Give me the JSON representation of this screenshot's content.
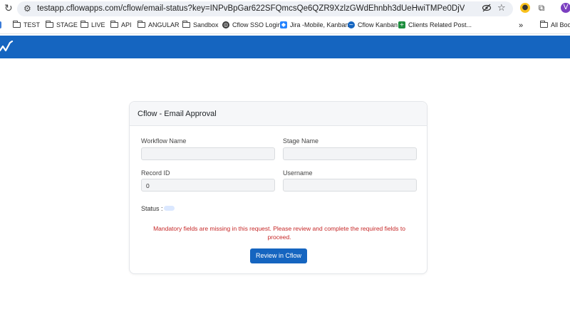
{
  "browser": {
    "url": "testapp.cflowapps.com/cflow/email-status?key=INPvBpGar622SFQmcsQe6QZR9XzlzGWdEhnbh3dUeHwiTMPe0DjV7DiliV9WpPuHm3WVFbOzB7jtUiyKJ2i...",
    "profile_initial": "V",
    "bookmarks": [
      "TEST",
      "STAGE",
      "LIVE",
      "API",
      "ANGULAR",
      "Sandbox",
      "Cflow SSO Login",
      "Jira -Mobile, Kanban",
      "Cflow Kanban",
      "Clients Related Post...",
      "All Book"
    ],
    "overflow": "»"
  },
  "colors": {
    "brand": "#1565c0",
    "error": "#c62828",
    "status_badge": "#dbe8ff"
  },
  "card": {
    "title": "Cflow - Email Approval",
    "fields": {
      "workflow_name": {
        "label": "Workflow Name",
        "value": ""
      },
      "stage_name": {
        "label": "Stage Name",
        "value": ""
      },
      "record_id": {
        "label": "Record ID",
        "value": "0"
      },
      "username": {
        "label": "Username",
        "value": ""
      }
    },
    "status_label": "Status :",
    "message": "Mandatory fields are missing in this request. Please review and complete the required fields to proceed.",
    "button_label": "Review in Cflow"
  }
}
